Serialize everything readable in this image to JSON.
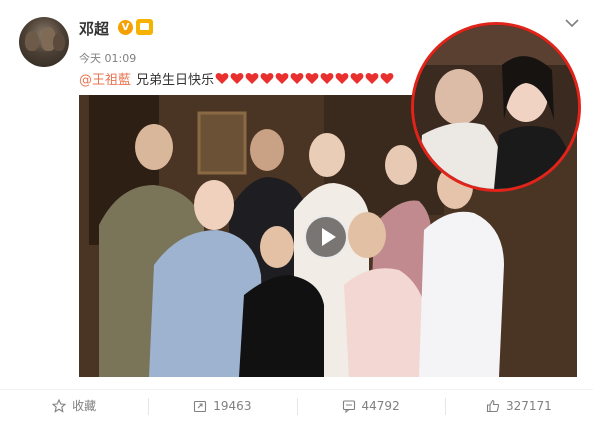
{
  "post": {
    "username": "邓超",
    "verified_badge": "V",
    "time": "今天 01:09",
    "mention": "@王祖藍",
    "message": "兄弟生日快乐",
    "heart_count": 12,
    "heart_color": "#e8312f"
  },
  "media": {
    "type": "video",
    "inset_highlight_color": "#e2231a"
  },
  "actions": {
    "favorite_label": "收藏",
    "repost_count": "19463",
    "comment_count": "44792",
    "like_count": "327171"
  },
  "colors": {
    "link": "#eb7350",
    "muted": "#808080",
    "verify": "#f5a000"
  }
}
